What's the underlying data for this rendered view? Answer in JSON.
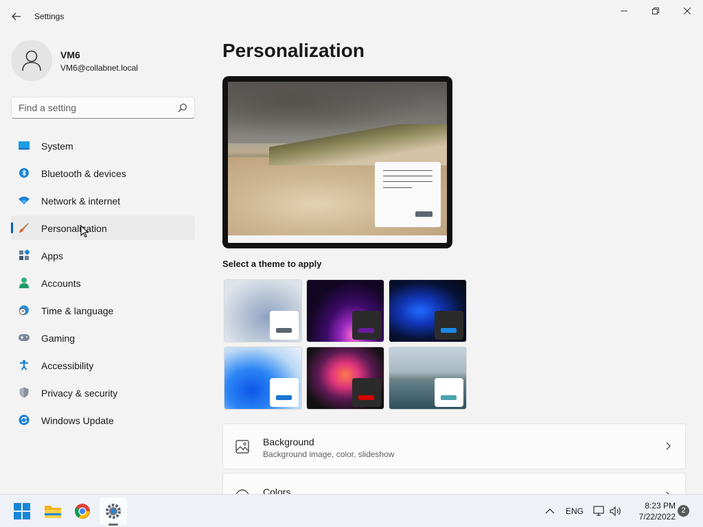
{
  "window": {
    "title": "Settings"
  },
  "profile": {
    "name": "VM6",
    "email": "VM6@collabnet.local"
  },
  "search": {
    "placeholder": "Find a setting",
    "value": ""
  },
  "sidebar": {
    "items": [
      {
        "label": "System",
        "icon": "system-icon"
      },
      {
        "label": "Bluetooth & devices",
        "icon": "bluetooth-icon"
      },
      {
        "label": "Network & internet",
        "icon": "wifi-icon"
      },
      {
        "label": "Personalization",
        "icon": "brush-icon",
        "active": true
      },
      {
        "label": "Apps",
        "icon": "apps-icon"
      },
      {
        "label": "Accounts",
        "icon": "account-icon"
      },
      {
        "label": "Time & language",
        "icon": "clock-globe-icon"
      },
      {
        "label": "Gaming",
        "icon": "gamepad-icon"
      },
      {
        "label": "Accessibility",
        "icon": "accessibility-icon"
      },
      {
        "label": "Privacy & security",
        "icon": "shield-icon"
      },
      {
        "label": "Windows Update",
        "icon": "update-icon"
      }
    ]
  },
  "main": {
    "title": "Personalization",
    "themes_label": "Select a theme to apply",
    "themes": [
      {
        "name": "theme-light-bloom",
        "card_color": "#ffffff",
        "swatch_color": "#5c6670"
      },
      {
        "name": "theme-glow",
        "card_color": "#2b2b2b",
        "swatch_color": "#6a1b9a"
      },
      {
        "name": "theme-dark-bloom",
        "card_color": "#2b2b2b",
        "swatch_color": "#1e88e5"
      },
      {
        "name": "theme-blue-bloom",
        "card_color": "#ffffff",
        "swatch_color": "#1976d2"
      },
      {
        "name": "theme-captured-motion",
        "card_color": "#2b2b2b",
        "swatch_color": "#d50000"
      },
      {
        "name": "theme-flow-lake",
        "card_color": "#ffffff",
        "swatch_color": "#4aa3ad"
      }
    ],
    "cards": [
      {
        "title": "Background",
        "subtitle": "Background image, color, slideshow",
        "icon": "picture-icon"
      },
      {
        "title": "Colors",
        "subtitle": "",
        "icon": "palette-icon"
      }
    ]
  },
  "taskbar": {
    "apps": [
      "start-icon",
      "file-explorer-icon",
      "chrome-icon",
      "settings-icon"
    ],
    "language": "ENG",
    "time": "8:23 PM",
    "date": "7/22/2022",
    "notifications": "2"
  },
  "colors": {
    "accent": "#005fb8"
  }
}
